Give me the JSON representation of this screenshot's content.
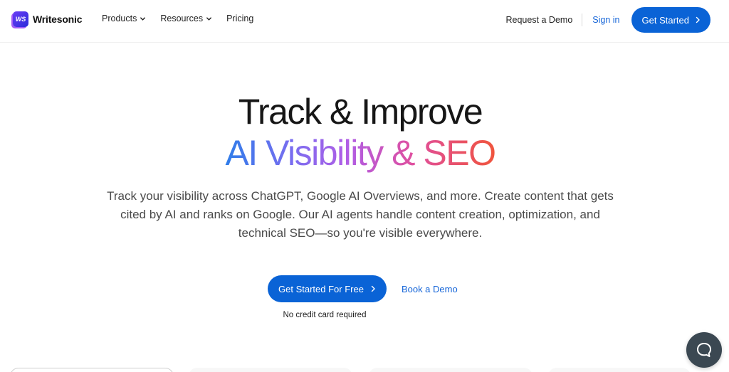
{
  "brand": {
    "logo_mark": "WS",
    "name": "Writesonic"
  },
  "nav": {
    "items": [
      {
        "label": "Products",
        "dropdown": true
      },
      {
        "label": "Resources",
        "dropdown": true
      },
      {
        "label": "Pricing",
        "dropdown": false
      }
    ],
    "request_demo": "Request a Demo",
    "sign_in": "Sign in",
    "get_started": "Get Started"
  },
  "hero": {
    "title_line1": "Track & Improve",
    "title_line2": "AI Visibility & SEO",
    "subtitle": "Track your visibility across ChatGPT, Google AI Overviews, and more. Create content that gets cited by AI and ranks on Google. Our AI agents handle content creation, optimization, and technical SEO—so you're visible everywhere.",
    "cta_primary": "Get Started For Free",
    "cta_secondary": "Book a Demo",
    "note": "No credit card required"
  },
  "icons": {
    "chevron": "chevron-down-icon",
    "arrow": "chevron-right-icon",
    "chat": "chat-bubble-icon"
  },
  "colors": {
    "primary": "#0a63d6",
    "link": "#1565d8",
    "gradient_start": "#2f7de9",
    "gradient_end": "#f0543c",
    "chat_button": "#3b4852"
  }
}
